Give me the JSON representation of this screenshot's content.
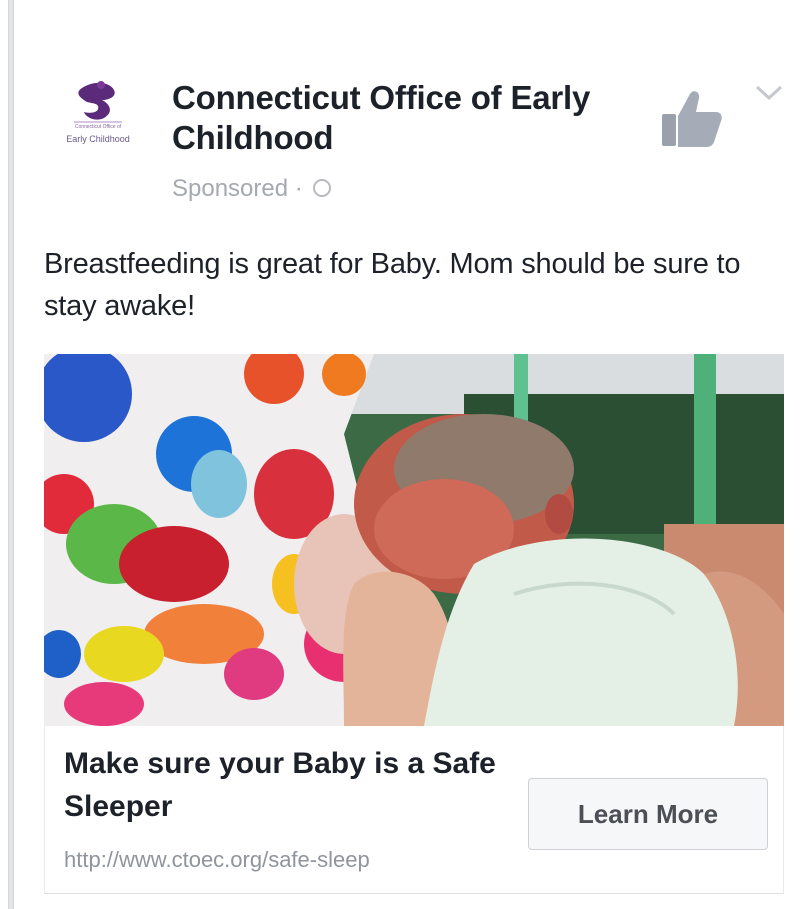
{
  "ad": {
    "advertiser": "Connecticut Office of Early Childhood",
    "sponsored_label": "Sponsored ·",
    "post_text": "Breastfeeding is great for Baby. Mom should be sure to stay awake!",
    "link": {
      "headline": "Make sure your Baby is a Safe Sleeper",
      "url": "http://www.ctoec.org/safe-sleep",
      "cta_label": "Learn More"
    },
    "logo_caption": "Early Childhood"
  },
  "icons": {
    "like": "thumbs-up-icon",
    "menu": "chevron-down-icon",
    "privacy": "globe-icon"
  },
  "colors": {
    "text_primary": "#1d2129",
    "text_secondary": "#90949c",
    "logo_purple": "#5b2a7a",
    "button_bg": "#f6f7f9"
  }
}
